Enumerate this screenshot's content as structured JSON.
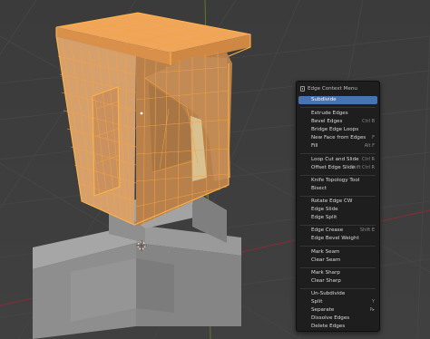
{
  "menu": {
    "title": "Edge Context Menu",
    "items": [
      {
        "label": "Subdivide",
        "shortcut": "",
        "active": true
      },
      {
        "label": "Extrude Edges",
        "shortcut": ""
      },
      {
        "label": "Bevel Edges",
        "shortcut": "Ctrl B"
      },
      {
        "label": "Bridge Edge Loops",
        "shortcut": ""
      },
      {
        "label": "New Face from Edges",
        "shortcut": "F"
      },
      {
        "label": "Fill",
        "shortcut": "Alt F"
      },
      {
        "label": "Loop Cut and Slide",
        "shortcut": "Ctrl R"
      },
      {
        "label": "Offset Edge Slide",
        "shortcut": "Shift Ctrl R"
      },
      {
        "label": "Knife Topology Tool",
        "shortcut": ""
      },
      {
        "label": "Bisect",
        "shortcut": ""
      },
      {
        "label": "Rotate Edge CW",
        "shortcut": ""
      },
      {
        "label": "Edge Slide",
        "shortcut": ""
      },
      {
        "label": "Edge Split",
        "shortcut": ""
      },
      {
        "label": "Edge Crease",
        "shortcut": "Shift E"
      },
      {
        "label": "Edge Bevel Weight",
        "shortcut": ""
      },
      {
        "label": "Mark Seam",
        "shortcut": ""
      },
      {
        "label": "Clear Seam",
        "shortcut": ""
      },
      {
        "label": "Mark Sharp",
        "shortcut": ""
      },
      {
        "label": "Clear Sharp",
        "shortcut": ""
      },
      {
        "label": "Un-Subdivide",
        "shortcut": ""
      },
      {
        "label": "Split",
        "shortcut": "Y"
      },
      {
        "label": "Separate",
        "shortcut": "P▸"
      },
      {
        "label": "Dissolve Edges",
        "shortcut": ""
      },
      {
        "label": "Delete Edges",
        "shortcut": ""
      }
    ]
  },
  "colors": {
    "viewport_bg": "#3d3d3d",
    "grid_line": "#474747",
    "axis_x": "#8b2b35",
    "axis_y": "#6a8a1d",
    "mesh_selected": "#e3913f",
    "wire_selected": "#f5a342",
    "mesh_base": "#8d8d8d",
    "menu_bg": "#1e1e1e",
    "menu_highlight": "#4772b3"
  },
  "icons": {
    "menu_title": "edge-icon",
    "cursor": "3d-cursor-icon"
  }
}
